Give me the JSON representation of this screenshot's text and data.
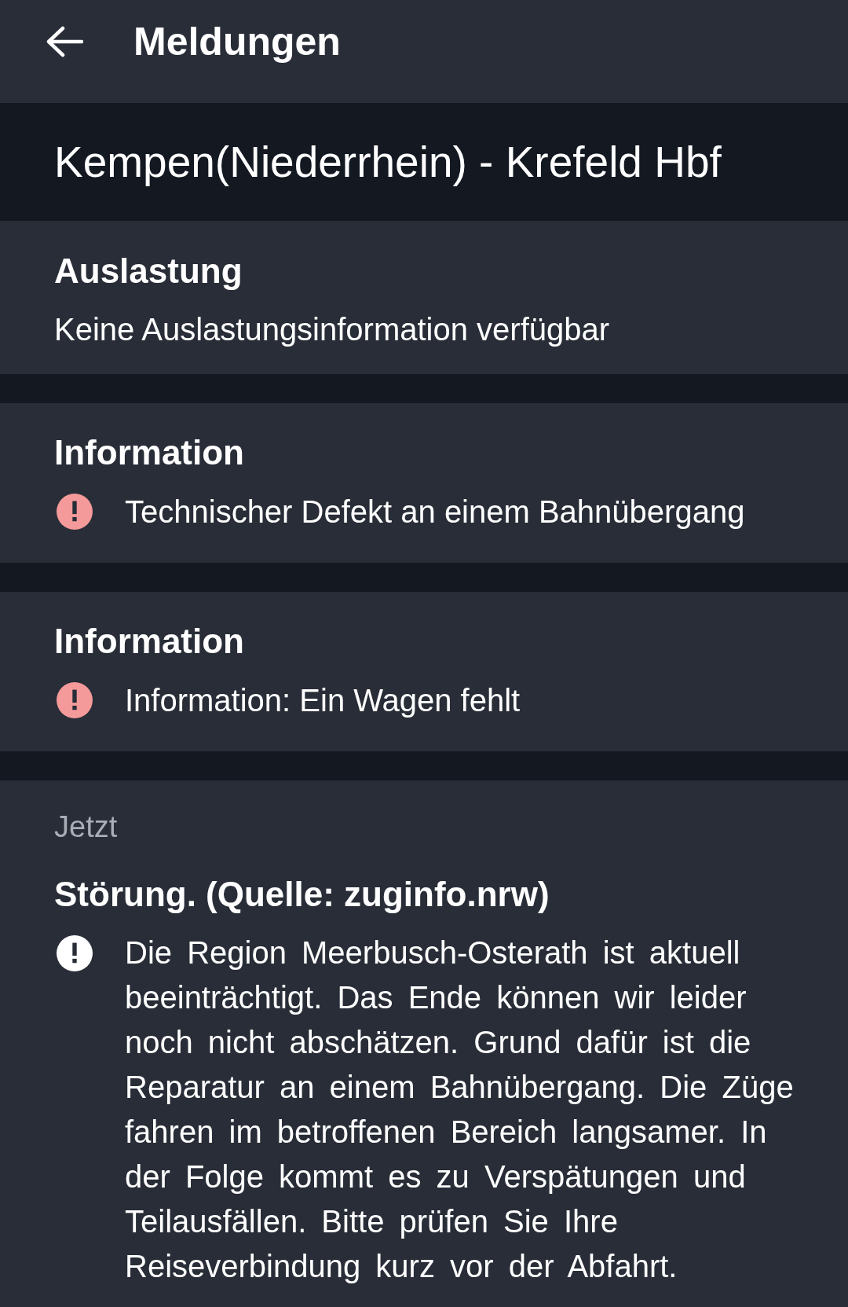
{
  "header": {
    "title": "Meldungen"
  },
  "route": {
    "title": "Kempen(Niederrhein) - Krefeld Hbf"
  },
  "sections": [
    {
      "kind": "occupancy",
      "title": "Auslastung",
      "text": "Keine Auslastungsinformation verfügbar"
    },
    {
      "kind": "message",
      "title": "Information",
      "color": "#f59a9a",
      "text": "Technischer Defekt an einem Bahnübergang"
    },
    {
      "kind": "message",
      "title": "Information",
      "color": "#f59a9a",
      "text": "Information: Ein Wagen fehlt"
    },
    {
      "kind": "message",
      "time": "Jetzt",
      "title": "Störung. (Quelle: zuginfo.nrw)",
      "color": "#ffffff",
      "text": "Die Region Meerbusch-Osterath ist aktuell beeinträchtigt. Das Ende können wir leider noch nicht abschätzen. Grund dafür ist die Reparatur an einem Bahnübergang. Die Züge fahren im betroffenen Bereich langsamer. In der Folge kommt es zu Verspätungen und Teilausfällen. Bitte prüfen Sie Ihre Reiseverbindung kurz vor der Abfahrt."
    }
  ]
}
